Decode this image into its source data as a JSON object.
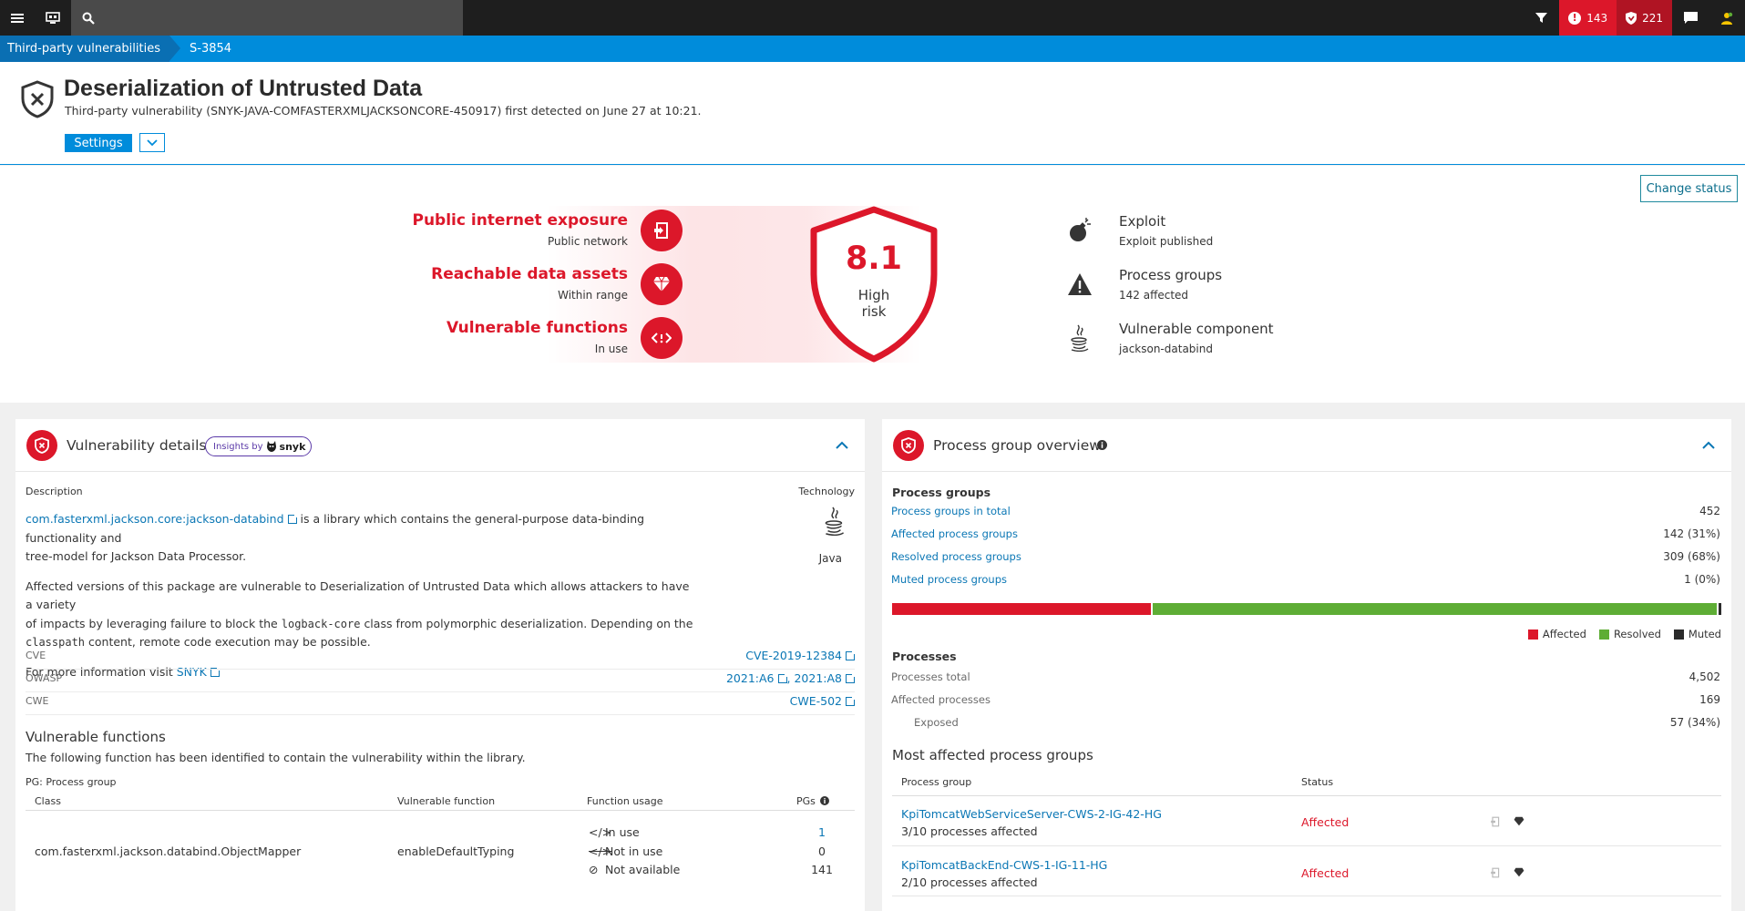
{
  "topbar": {
    "menu_icon": "menu-icon",
    "search_icon": "search-icon",
    "filter_icon": "filter-icon",
    "problems_count": "143",
    "vulnerabilities_count": "221",
    "chat_icon": "chat-icon",
    "user_icon": "user-icon"
  },
  "breadcrumb": {
    "items": [
      "Third-party vulnerabilities",
      "S-3854"
    ]
  },
  "header": {
    "title": "Deserialization of Untrusted Data",
    "subtitle": "Third-party vulnerability (SNYK-JAVA-COMFASTERXMLJACKSONCORE-450917) first detected on June 27 at 10:21.",
    "settings_label": "Settings"
  },
  "risk": {
    "change_status_label": "Change status",
    "factors": [
      {
        "title": "Public internet exposure",
        "sub": "Public network"
      },
      {
        "title": "Reachable data assets",
        "sub": "Within range"
      },
      {
        "title": "Vulnerable functions",
        "sub": "In use"
      }
    ],
    "score": "8.1",
    "level_line1": "High",
    "level_line2": "risk",
    "info": [
      {
        "title": "Exploit",
        "sub": "Exploit published",
        "icon": "bomb-icon"
      },
      {
        "title": "Process groups",
        "sub": "142 affected",
        "icon": "warning-icon"
      },
      {
        "title": "Vulnerable component",
        "sub": "jackson-databind",
        "icon": "java-icon"
      }
    ]
  },
  "vuln_details": {
    "title": "Vulnerability details",
    "insights_by": "Insights by",
    "snyk": "snyk",
    "description_label": "Description",
    "technology_label": "Technology",
    "technology": "Java",
    "lib_link": "com.fasterxml.jackson.core:jackson-databind",
    "para1_rest": "is a library which contains the general-purpose data-binding functionality and",
    "para1_line2": "tree-model for Jackson Data Processor.",
    "para2_line1": "Affected versions of this package are vulnerable to Deserialization of Untrusted Data which allows attackers to have a variety",
    "para2_line2_a": "of impacts by leveraging failure to block the",
    "para2_code1": "logback-core",
    "para2_line2_b": "class from polymorphic deserialization. Depending on the",
    "para2_code2": "classpath",
    "para2_line3_b": "content, remote code execution may be possible.",
    "more_info": "For more information visit",
    "more_info_link": "SNYK",
    "cve_label": "CVE",
    "cve_value": "CVE-2019-12384",
    "owasp_label": "OWASP",
    "owasp_value1": "2021:A6",
    "owasp_value2": "2021:A8",
    "cwe_label": "CWE",
    "cwe_value": "CWE-502",
    "vf_title": "Vulnerable functions",
    "vf_desc": "The following function has been identified to contain the vulnerability within the library.",
    "pg_note": "PG: Process group",
    "table_headers": [
      "Class",
      "Vulnerable function",
      "Function usage",
      "PGs"
    ],
    "row": {
      "class": "com.fasterxml.jackson.databind.ObjectMapper",
      "function": "enableDefaultTyping",
      "usage": [
        {
          "label": "In use",
          "count": "1"
        },
        {
          "label": "Not in use",
          "count": "0"
        },
        {
          "label": "Not available",
          "count": "141"
        }
      ]
    }
  },
  "pg_overview": {
    "title": "Process group overview",
    "pg_heading": "Process groups",
    "pg_rows": [
      {
        "label": "Process groups in total",
        "value": "452"
      },
      {
        "label": "Affected process groups",
        "value": "142 (31%)"
      },
      {
        "label": "Resolved process groups",
        "value": "309 (68%)"
      },
      {
        "label": "Muted process groups",
        "value": "1 (0%)"
      }
    ],
    "bar": {
      "affected": 142,
      "resolved": 309,
      "muted": 1
    },
    "legend": [
      "Affected",
      "Resolved",
      "Muted"
    ],
    "colors": {
      "affected": "#dc172a",
      "resolved": "#5ead35",
      "muted": "#2b2b2b"
    },
    "processes_heading": "Processes",
    "proc_rows": [
      {
        "label": "Processes total",
        "value": "4,502"
      },
      {
        "label": "Affected processes",
        "value": "169"
      },
      {
        "label": "Exposed",
        "value": "57 (34%)"
      }
    ],
    "mag_title": "Most affected process groups",
    "mag_headers": [
      "Process group",
      "Status"
    ],
    "mag_rows": [
      {
        "name": "KpiTomcatWebServiceServer-CWS-2-IG-42-HG",
        "sub": "3/10 processes affected",
        "status": "Affected"
      },
      {
        "name": "KpiTomcatBackEnd-CWS-1-IG-11-HG",
        "sub": "2/10 processes affected",
        "status": "Affected"
      }
    ]
  }
}
